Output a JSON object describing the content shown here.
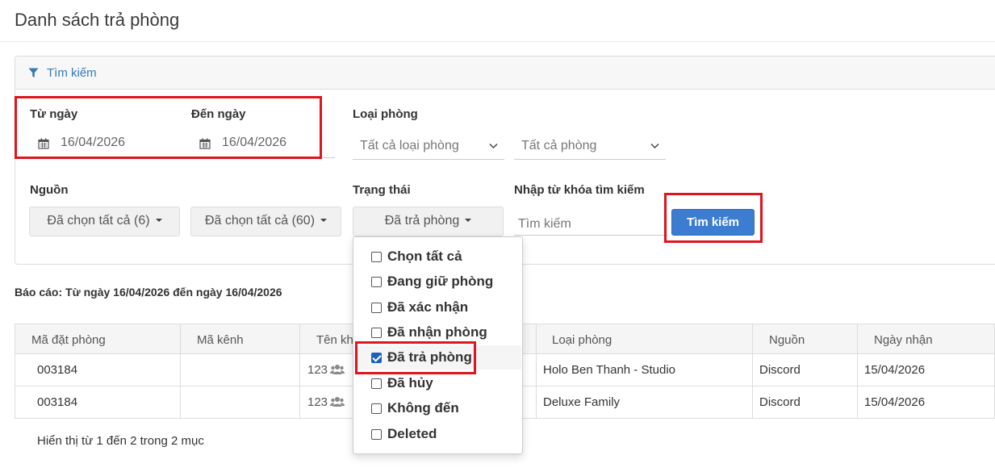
{
  "page": {
    "title": "Danh sách trả phòng"
  },
  "search_panel": {
    "header": "Tìm kiếm",
    "from_date": {
      "label": "Từ ngày",
      "value": "16/04/2026"
    },
    "to_date": {
      "label": "Đến ngày",
      "value": "16/04/2026"
    },
    "room_type": {
      "label": "Loại phòng",
      "selected": "Tất cả loại phòng"
    },
    "room": {
      "selected": "Tất cả phòng"
    },
    "source": {
      "label": "Nguồn",
      "selected": "Đã chọn tất cả (6)"
    },
    "channel": {
      "selected": "Đã chọn tất cả (60)"
    },
    "status": {
      "label": "Trạng thái",
      "selected": "Đã trả phòng",
      "options": [
        {
          "label": "Chọn tất cả",
          "checked": false
        },
        {
          "label": "Đang giữ phòng",
          "checked": false
        },
        {
          "label": "Đã xác nhận",
          "checked": false
        },
        {
          "label": "Đã nhận phòng",
          "checked": false
        },
        {
          "label": "Đã trả phòng",
          "checked": true
        },
        {
          "label": "Đã hủy",
          "checked": false
        },
        {
          "label": "Không đến",
          "checked": false
        },
        {
          "label": "Deleted",
          "checked": false
        }
      ]
    },
    "keyword": {
      "label": "Nhập từ khóa tìm kiếm",
      "placeholder": "Tìm kiếm",
      "value": ""
    },
    "search_button": "Tìm kiếm"
  },
  "report_text": "Báo cáo: Từ ngày 16/04/2026 đến ngày 16/04/2026",
  "table": {
    "columns": [
      "Mã đặt phòng",
      "Mã kênh",
      "Tên kh",
      "Loại phòng",
      "Nguồn",
      "Ngày nhận"
    ],
    "rows": [
      {
        "booking_code": "003184",
        "channel_code": "",
        "guest": "123",
        "room_type": "Holo Ben Thanh - Studio",
        "source": "Discord",
        "checkin_date": "15/04/2026"
      },
      {
        "booking_code": "003184",
        "channel_code": "",
        "guest": "123",
        "room_type": "Deluxe Family",
        "source": "Discord",
        "checkin_date": "15/04/2026"
      }
    ]
  },
  "footer_info": "Hiển thị từ 1 đến 2 trong 2 mục",
  "colors": {
    "primary": "#3c7dd1",
    "link": "#337ab7",
    "highlight": "#e0141e",
    "checkbox": "#1f5fb8"
  }
}
